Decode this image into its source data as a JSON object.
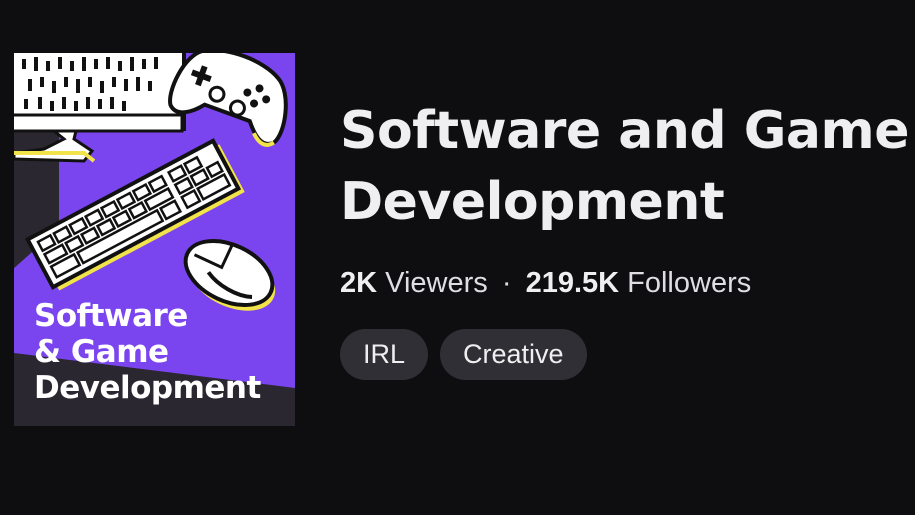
{
  "box_art": {
    "title_lines": [
      "Software",
      "& Game",
      "Development"
    ],
    "colors": {
      "purple": "#7a45ee",
      "dark": "#2a2730",
      "white": "#ffffff",
      "yellow": "#f3e34a"
    },
    "icons": [
      "monitor-icon",
      "gamepad-icon",
      "keyboard-icon",
      "mouse-icon"
    ]
  },
  "category": {
    "title_line1": "Software and Game",
    "title_line2": "Development",
    "viewers_count": "2K",
    "viewers_label": "Viewers",
    "separator": "·",
    "followers_count": "219.5K",
    "followers_label": "Followers"
  },
  "tags": [
    {
      "label": "IRL"
    },
    {
      "label": "Creative"
    }
  ]
}
